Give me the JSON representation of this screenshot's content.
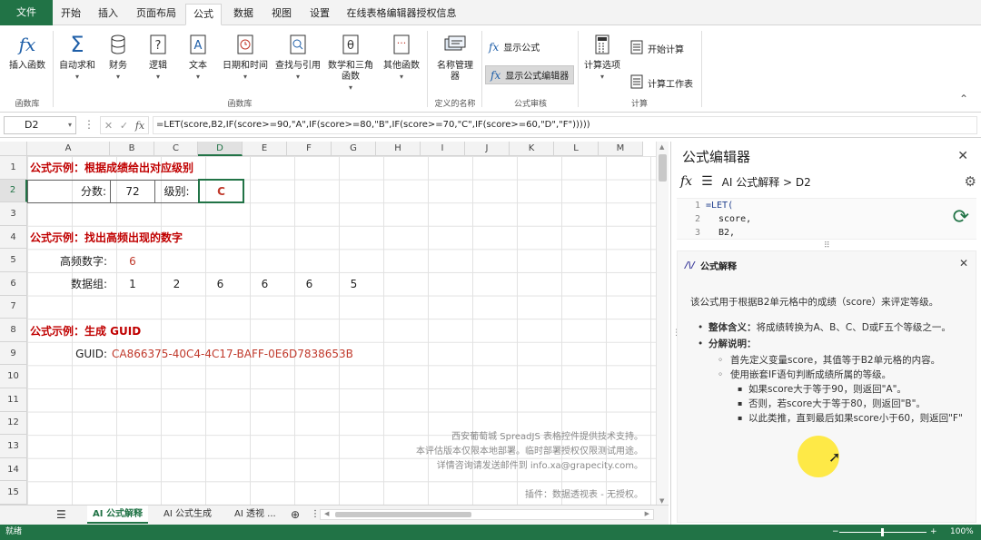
{
  "tabs": [
    {
      "label": "文件"
    },
    {
      "label": "开始"
    },
    {
      "label": "插入"
    },
    {
      "label": "页面布局"
    },
    {
      "label": "公式"
    },
    {
      "label": "数据"
    },
    {
      "label": "视图"
    },
    {
      "label": "设置"
    },
    {
      "label": "在线表格编辑器授权信息"
    }
  ],
  "ribbon": {
    "insert_fn": "插入函数",
    "autosum": "自动求和",
    "finance": "财务",
    "logic": "逻辑",
    "text": "文本",
    "datetime": "日期和时间",
    "lookup": "查找与引用",
    "math1": "数学和三角",
    "math2": "函数",
    "other": "其他函数",
    "name_mgr1": "名称管理",
    "name_mgr2": "器",
    "show_formula": "显示公式",
    "show_formula_editor": "显示公式编辑器",
    "calc_options": "计算选项",
    "start_calc": "开始计算",
    "calc_sheet": "计算工作表",
    "group_fnlib_left": "函数库",
    "group_fnlib": "函数库",
    "group_names": "定义的名称",
    "group_audit": "公式审核",
    "group_calc": "计算"
  },
  "formula_bar": {
    "name_box": "D2",
    "fx": "fx",
    "formula": "=LET(score,B2,IF(score>=90,\"A\",IF(score>=80,\"B\",IF(score>=70,\"C\",IF(score>=60,\"D\",\"F\")))))"
  },
  "sheet": {
    "columns": [
      "A",
      "B",
      "C",
      "D",
      "E",
      "F",
      "G",
      "H",
      "I",
      "J",
      "K",
      "L",
      "M"
    ],
    "rows": [
      "1",
      "2",
      "3",
      "4",
      "5",
      "6",
      "7",
      "8",
      "9",
      "10",
      "11",
      "12",
      "13",
      "14",
      "15"
    ],
    "cells": {
      "a1": "公式示例：根据成绩给出对应级别",
      "a2": "分数:",
      "b2": "72",
      "c2": "级别:",
      "d2": "C",
      "a4": "公式示例：找出高频出现的数字",
      "a5": "高频数字:",
      "b5": "6",
      "a6": "数据组:",
      "b6": "1",
      "c6": "2",
      "d6": "6",
      "e6": "6",
      "f6": "6",
      "g6": "5",
      "a8": "公式示例：生成 GUID",
      "a9": "GUID:",
      "b9": "CA866375-40C4-4C17-BAFF-0E6D7838653B"
    },
    "watermark": [
      "西安葡萄城 SpreadJS 表格控件提供技术支持。",
      "本评估版本仅限本地部署。临时部署授权仅限测试用途。",
      "详情咨询请发送邮件到 info.xa@grapecity.com。",
      "插件：数据透视表 - 无授权。"
    ]
  },
  "sheet_tabs": [
    "AI 公式解释",
    "AI 公式生成",
    "AI 透视 ..."
  ],
  "status": {
    "ready": "就绪",
    "zoom": "100%"
  },
  "panel": {
    "title": "公式编辑器",
    "breadcrumb": "AI 公式解释 > D2",
    "code": [
      {
        "n": "1",
        "text": "=LET("
      },
      {
        "n": "2",
        "text": "score,"
      },
      {
        "n": "3",
        "text": "B2,"
      }
    ],
    "explain_title": "公式解释",
    "intro": "该公式用于根据B2单元格中的成绩（score）来评定等级。",
    "b1_label": "整体含义：",
    "b1_text": "将成绩转换为A、B、C、D或F五个等级之一。",
    "b2_label": "分解说明：",
    "s1": "首先定义变量score，其值等于B2单元格的内容。",
    "s2": "使用嵌套IF语句判断成绩所属的等级。",
    "t1": "如果score大于等于90，则返回\"A\"。",
    "t2": "否则，若score大于等于80，则返回\"B\"。",
    "t3": "以此类推，直到最后如果score小于60，则返回\"F\""
  },
  "colors": {
    "accent": "#217346",
    "title_red": "#c00000",
    "value_red": "#c0392b"
  }
}
